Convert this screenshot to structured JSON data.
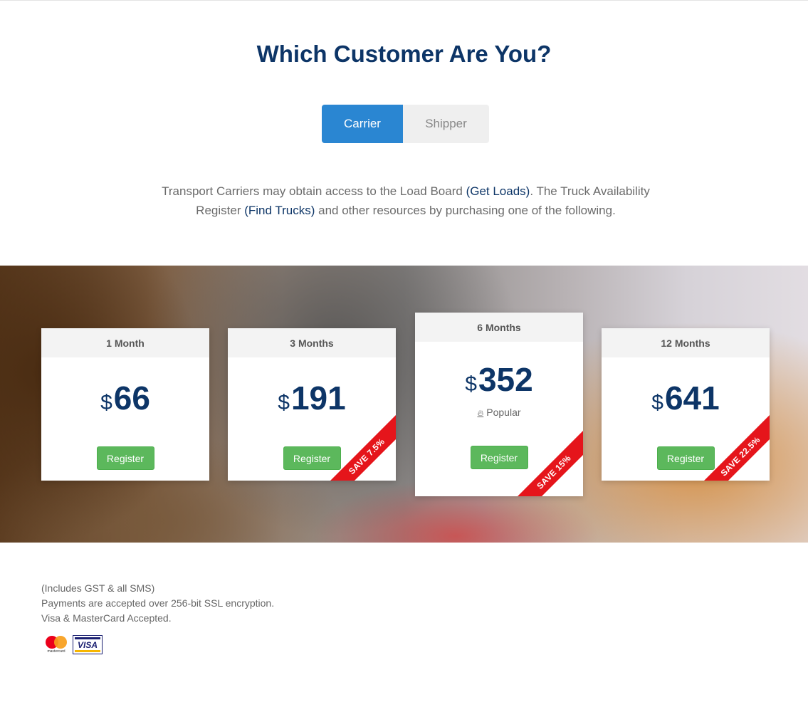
{
  "header": {
    "title": "Which Customer Are You?"
  },
  "toggle": {
    "carrier_label": "Carrier",
    "shipper_label": "Shipper",
    "selected": "Carrier"
  },
  "intro": {
    "part1": "Transport Carriers may obtain access to the Load Board ",
    "link1": "(Get Loads)",
    "part2": ". The Truck Availability Register ",
    "link2": "(Find Trucks)",
    "part3": " and other resources by purchasing one of the following."
  },
  "plans": [
    {
      "period": "1 Month",
      "currency": "$",
      "price": "66",
      "button": "Register",
      "popular": "",
      "ribbon": ""
    },
    {
      "period": "3 Months",
      "currency": "$",
      "price": "191",
      "button": "Register",
      "popular": "",
      "ribbon": "SAVE 7.5%"
    },
    {
      "period": "6 Months",
      "currency": "$",
      "price": "352",
      "button": "Register",
      "popular": "Popular",
      "ribbon": "SAVE 15%"
    },
    {
      "period": "12 Months",
      "currency": "$",
      "price": "641",
      "button": "Register",
      "popular": "",
      "ribbon": "SAVE 22.5%"
    }
  ],
  "notes": {
    "line1": "(Includes GST & all SMS)",
    "line2": "Payments are accepted over 256-bit SSL encryption.",
    "line3": "Visa & MasterCard Accepted."
  },
  "payment_logos": {
    "mastercard_text": "mastercard",
    "visa_text": "VISA"
  },
  "colors": {
    "title": "#0d3567",
    "toggle_active": "#2a86d2",
    "register_button": "#5cb85c",
    "ribbon": "#e5151b",
    "link": "#0d3567"
  },
  "icons": {
    "popular": "fire-icon"
  }
}
